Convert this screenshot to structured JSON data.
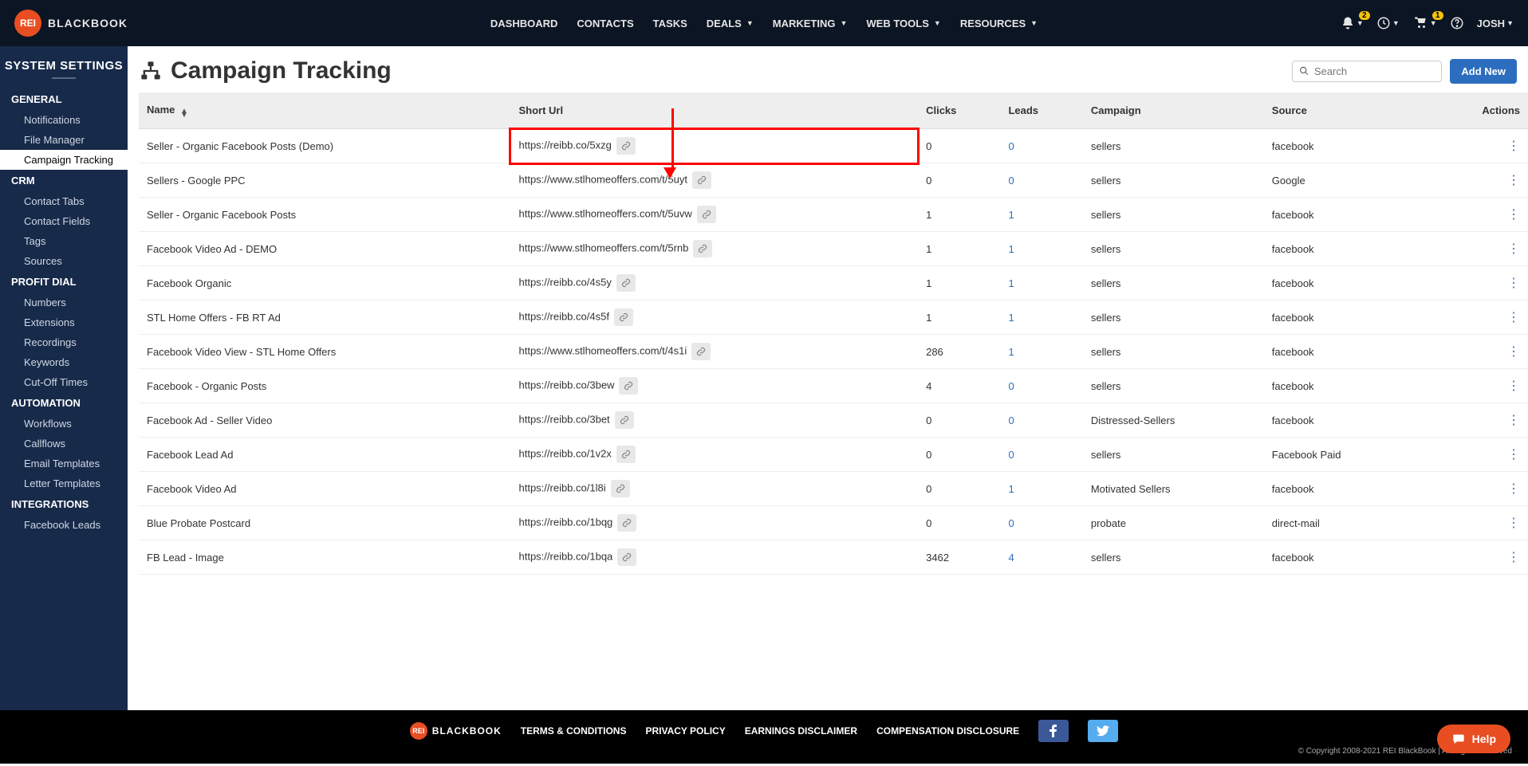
{
  "nav": {
    "logo_badge": "REI",
    "logo_text": "BLACKBOOK",
    "items": [
      {
        "label": "DASHBOARD",
        "dropdown": false
      },
      {
        "label": "CONTACTS",
        "dropdown": false
      },
      {
        "label": "TASKS",
        "dropdown": false
      },
      {
        "label": "DEALS",
        "dropdown": true
      },
      {
        "label": "MARKETING",
        "dropdown": true
      },
      {
        "label": "WEB TOOLS",
        "dropdown": true
      },
      {
        "label": "RESOURCES",
        "dropdown": true
      }
    ],
    "bell_badge": "2",
    "cart_badge": "1",
    "username": "JOSH"
  },
  "sidebar": {
    "title": "SYSTEM SETTINGS",
    "groups": [
      {
        "label": "GENERAL",
        "items": [
          "Notifications",
          "File Manager",
          "Campaign Tracking"
        ],
        "active_index": 2
      },
      {
        "label": "CRM",
        "items": [
          "Contact Tabs",
          "Contact Fields",
          "Tags",
          "Sources"
        ],
        "active_index": -1
      },
      {
        "label": "PROFIT DIAL",
        "items": [
          "Numbers",
          "Extensions",
          "Recordings",
          "Keywords",
          "Cut-Off Times"
        ],
        "active_index": -1
      },
      {
        "label": "AUTOMATION",
        "items": [
          "Workflows",
          "Callflows",
          "Email Templates",
          "Letter Templates"
        ],
        "active_index": -1
      },
      {
        "label": "INTEGRATIONS",
        "items": [
          "Facebook Leads"
        ],
        "active_index": -1
      }
    ]
  },
  "page": {
    "title": "Campaign Tracking",
    "search_placeholder": "Search",
    "add_new": "Add New"
  },
  "table": {
    "headers": {
      "name": "Name",
      "short_url": "Short Url",
      "clicks": "Clicks",
      "leads": "Leads",
      "campaign": "Campaign",
      "source": "Source",
      "actions": "Actions"
    },
    "rows": [
      {
        "name": "Seller - Organic Facebook Posts (Demo)",
        "url": "https://reibb.co/5xzg",
        "clicks": "0",
        "leads": "0",
        "campaign": "sellers",
        "source": "facebook",
        "highlight": true
      },
      {
        "name": "Sellers - Google PPC",
        "url": "https://www.stlhomeoffers.com/t/5uyt",
        "clicks": "0",
        "leads": "0",
        "campaign": "sellers",
        "source": "Google"
      },
      {
        "name": "Seller - Organic Facebook Posts",
        "url": "https://www.stlhomeoffers.com/t/5uvw",
        "clicks": "1",
        "leads": "1",
        "campaign": "sellers",
        "source": "facebook"
      },
      {
        "name": "Facebook Video Ad - DEMO",
        "url": "https://www.stlhomeoffers.com/t/5rnb",
        "clicks": "1",
        "leads": "1",
        "campaign": "sellers",
        "source": "facebook"
      },
      {
        "name": "Facebook Organic",
        "url": "https://reibb.co/4s5y",
        "clicks": "1",
        "leads": "1",
        "campaign": "sellers",
        "source": "facebook"
      },
      {
        "name": "STL Home Offers - FB RT Ad",
        "url": "https://reibb.co/4s5f",
        "clicks": "1",
        "leads": "1",
        "campaign": "sellers",
        "source": "facebook"
      },
      {
        "name": "Facebook Video View - STL Home Offers",
        "url": "https://www.stlhomeoffers.com/t/4s1i",
        "clicks": "286",
        "leads": "1",
        "campaign": "sellers",
        "source": "facebook"
      },
      {
        "name": "Facebook - Organic Posts",
        "url": "https://reibb.co/3bew",
        "clicks": "4",
        "leads": "0",
        "campaign": "sellers",
        "source": "facebook"
      },
      {
        "name": "Facebook Ad - Seller Video",
        "url": "https://reibb.co/3bet",
        "clicks": "0",
        "leads": "0",
        "campaign": "Distressed-Sellers",
        "source": "facebook"
      },
      {
        "name": "Facebook Lead Ad",
        "url": "https://reibb.co/1v2x",
        "clicks": "0",
        "leads": "0",
        "campaign": "sellers",
        "source": "Facebook Paid"
      },
      {
        "name": "Facebook Video Ad",
        "url": "https://reibb.co/1l8i",
        "clicks": "0",
        "leads": "1",
        "campaign": "Motivated Sellers",
        "source": "facebook"
      },
      {
        "name": "Blue Probate Postcard",
        "url": "https://reibb.co/1bqg",
        "clicks": "0",
        "leads": "0",
        "campaign": "probate",
        "source": "direct-mail"
      },
      {
        "name": "FB Lead - Image",
        "url": "https://reibb.co/1bqa",
        "clicks": "3462",
        "leads": "4",
        "campaign": "sellers",
        "source": "facebook"
      }
    ]
  },
  "footer": {
    "logo_badge": "REI",
    "logo_text": "BLACKBOOK",
    "links": [
      "TERMS & CONDITIONS",
      "PRIVACY POLICY",
      "EARNINGS DISCLAIMER",
      "COMPENSATION DISCLOSURE"
    ],
    "copyright": "© Copyright 2008-2021 REI BlackBook | All Rights Reserved"
  },
  "help": {
    "label": "Help"
  }
}
